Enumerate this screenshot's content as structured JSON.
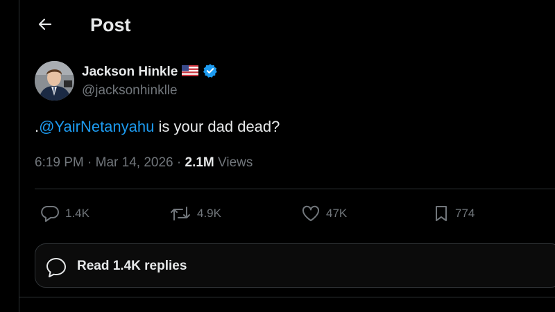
{
  "header": {
    "title": "Post"
  },
  "author": {
    "name": "Jackson Hinkle",
    "handle": "@jacksonhinklle",
    "flag_icon": "us-flag-icon",
    "verified_icon": "verified-badge-icon",
    "verified_color": "#1d9bf0"
  },
  "post": {
    "prefix": ".",
    "mention": "@YairNetanyahu",
    "text": " is your dad dead?",
    "time": "6:19 PM",
    "separator": " · ",
    "date": "Mar 14, 2026",
    "views_count": "2.1M",
    "views_label": " Views"
  },
  "actions": {
    "replies": "1.4K",
    "reposts": "4.9K",
    "likes": "47K",
    "bookmarks": "774"
  },
  "replies_button": {
    "label": "Read 1.4K replies"
  },
  "colors": {
    "background": "#000000",
    "text": "#e7e9ea",
    "muted": "#71767b",
    "accent": "#1d9bf0",
    "border": "#2f3336"
  }
}
